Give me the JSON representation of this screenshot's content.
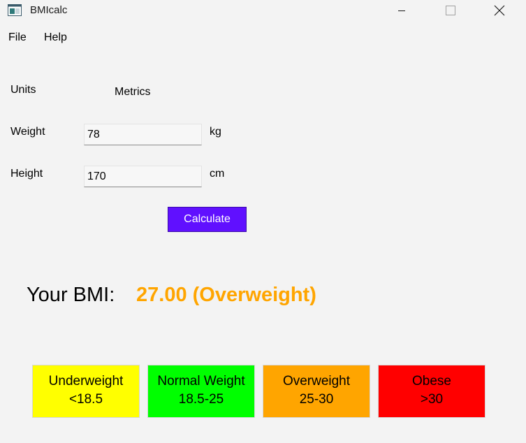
{
  "window": {
    "title": "BMIcalc",
    "controls": {
      "minimize": "minimize-icon",
      "maximize": "maximize-icon",
      "close": "close-icon"
    }
  },
  "menu": {
    "items": [
      {
        "label": "File"
      },
      {
        "label": "Help"
      }
    ]
  },
  "form": {
    "units": {
      "label": "Units",
      "value": "Metrics"
    },
    "weight": {
      "label": "Weight",
      "value": "78",
      "unit": "kg"
    },
    "height": {
      "label": "Height",
      "value": "170",
      "unit": "cm"
    },
    "calculate_label": "Calculate"
  },
  "result": {
    "label": "Your BMI:",
    "value": "27.00 (Overweight)",
    "color": "#ffa500"
  },
  "categories": [
    {
      "name": "Underweight",
      "range": "<18.5",
      "color": "#ffff00"
    },
    {
      "name": "Normal Weight",
      "range": "18.5-25",
      "color": "#00ff00"
    },
    {
      "name": "Overweight",
      "range": "25-30",
      "color": "#ffa500"
    },
    {
      "name": "Obese",
      "range": ">30",
      "color": "#ff0000"
    }
  ],
  "colors": {
    "accent": "#6010ff",
    "background": "#f3f3f3"
  }
}
